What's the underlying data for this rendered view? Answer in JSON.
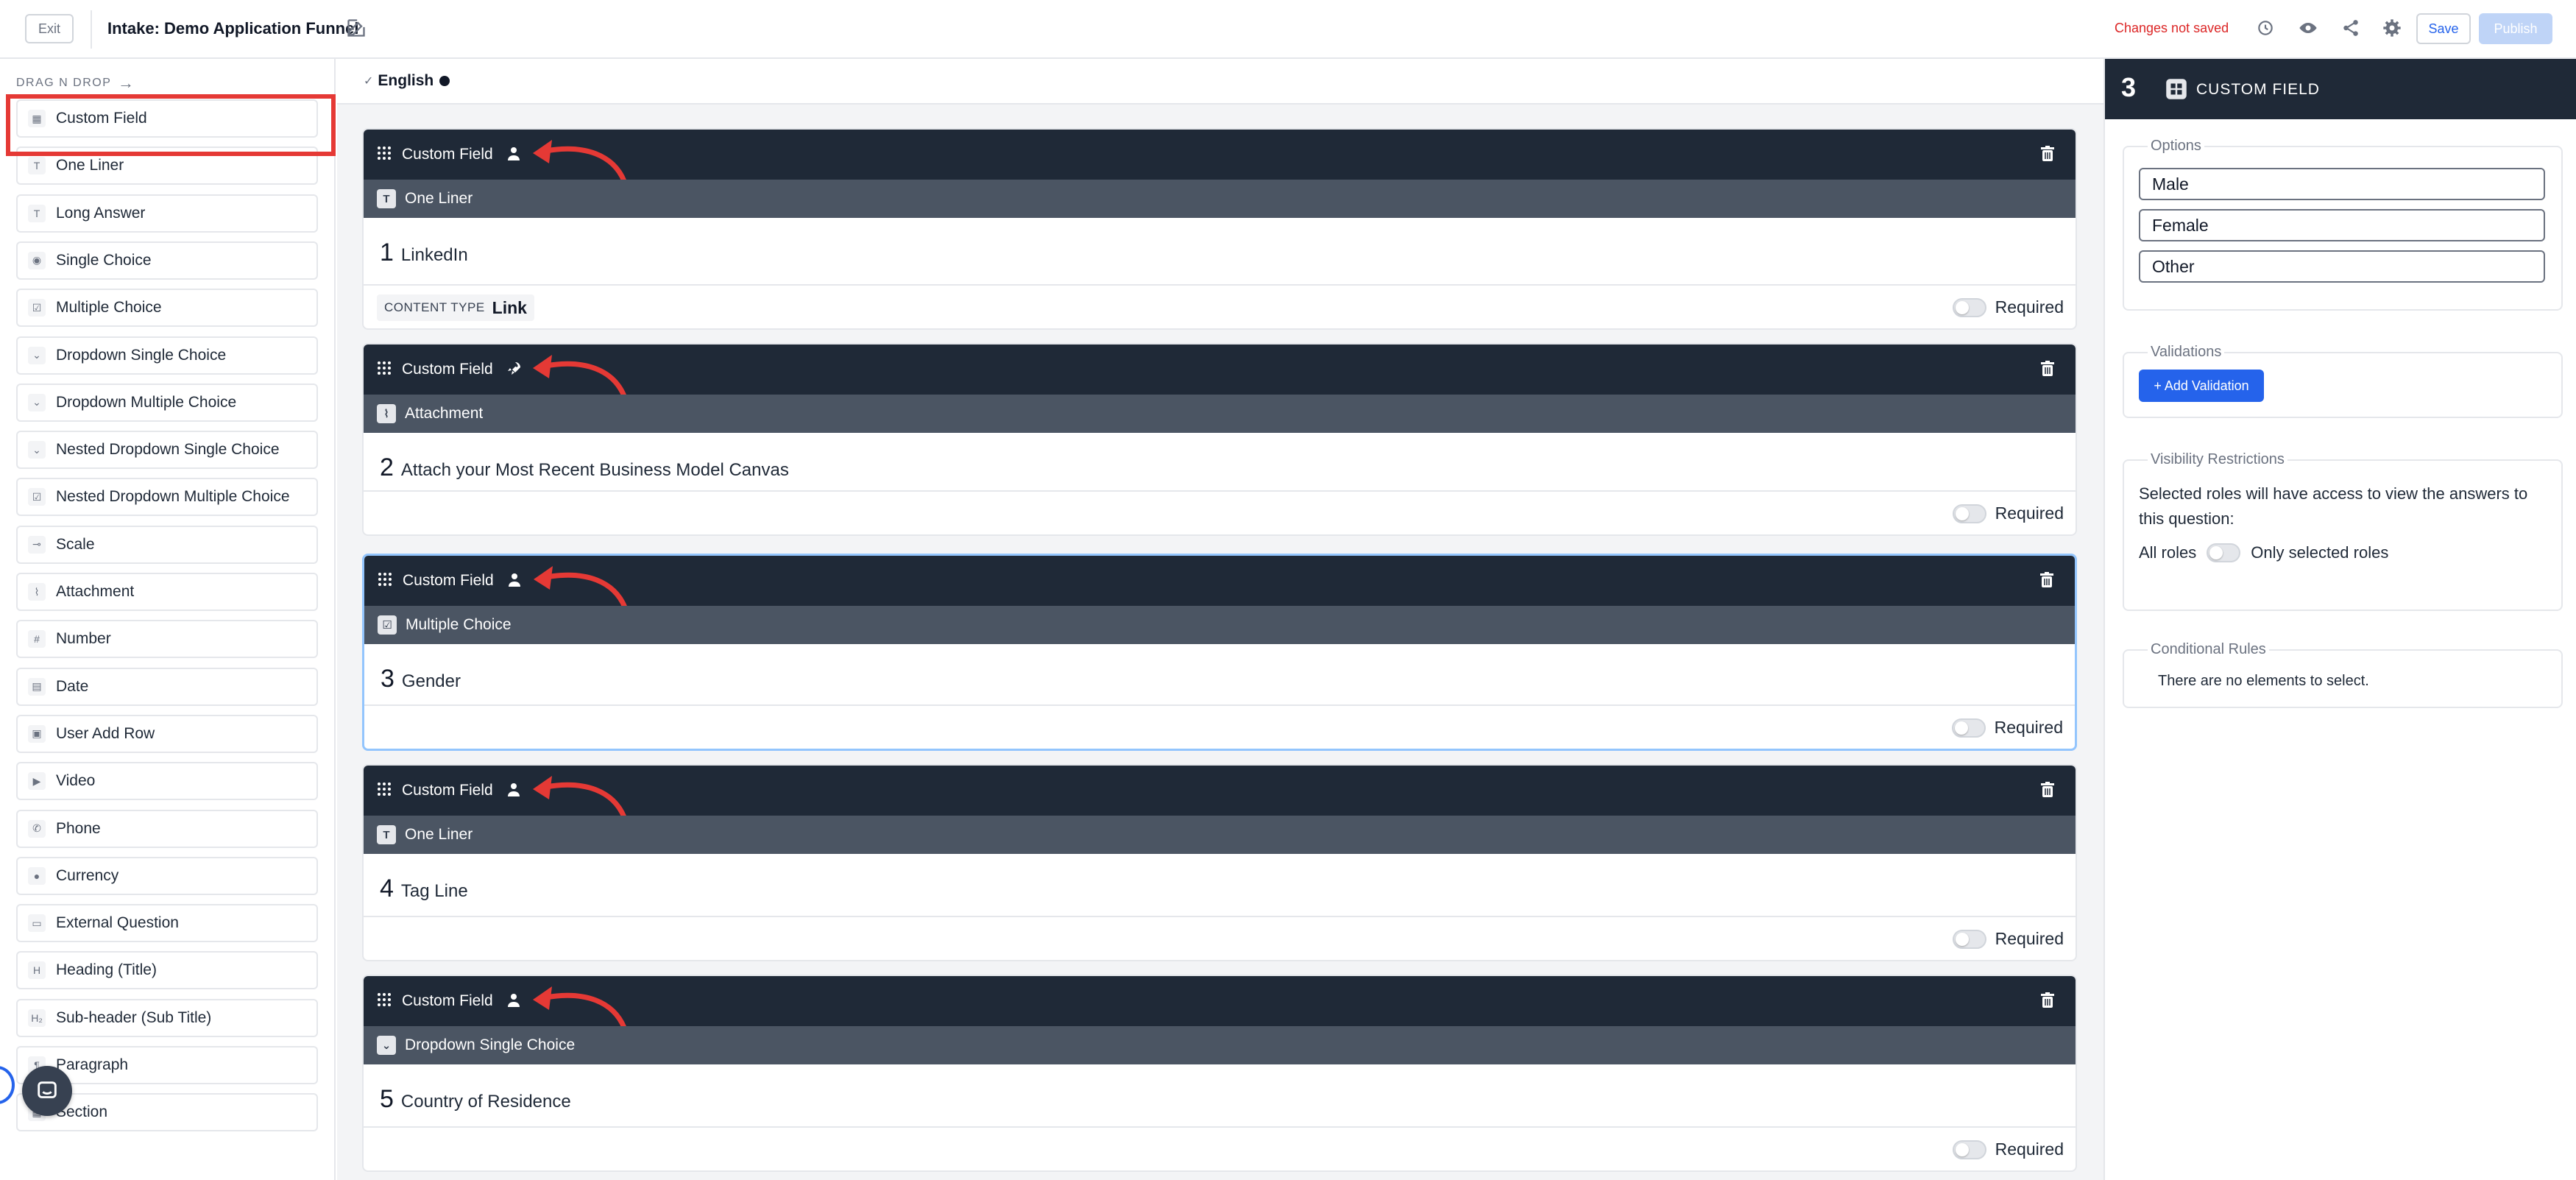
{
  "topbar": {
    "exit_label": "Exit",
    "app_title": "Intake: Demo Application Funnel",
    "unsaved_label": "Changes not saved",
    "save_label": "Save",
    "publish_label": "Publish"
  },
  "sidebar": {
    "heading": "DRAG N DROP",
    "arrow": "→",
    "items": [
      {
        "label": "Custom Field",
        "icon": "grid-icon",
        "glyph": "▦"
      },
      {
        "label": "One Liner",
        "icon": "text-icon",
        "glyph": "T"
      },
      {
        "label": "Long Answer",
        "icon": "text-icon",
        "glyph": "T"
      },
      {
        "label": "Single Choice",
        "icon": "choice-icon",
        "glyph": "◉"
      },
      {
        "label": "Multiple Choice",
        "icon": "choice-icon",
        "glyph": "☑"
      },
      {
        "label": "Dropdown Single Choice",
        "icon": "chevron-down-icon",
        "glyph": "⌄"
      },
      {
        "label": "Dropdown Multiple Choice",
        "icon": "chevron-down-icon",
        "glyph": "⌄"
      },
      {
        "label": "Nested Dropdown Single Choice",
        "icon": "chevron-down-icon",
        "glyph": "⌄"
      },
      {
        "label": "Nested Dropdown Multiple Choice",
        "icon": "choice-icon",
        "glyph": "☑"
      },
      {
        "label": "Scale",
        "icon": "scale-icon",
        "glyph": "⊸"
      },
      {
        "label": "Attachment",
        "icon": "paperclip-icon",
        "glyph": "⌇"
      },
      {
        "label": "Number",
        "icon": "hash-icon",
        "glyph": "#"
      },
      {
        "label": "Date",
        "icon": "calendar-icon",
        "glyph": "▤"
      },
      {
        "label": "User Add Row",
        "icon": "rows-icon",
        "glyph": "▣"
      },
      {
        "label": "Video",
        "icon": "video-icon",
        "glyph": "▶"
      },
      {
        "label": "Phone",
        "icon": "phone-icon",
        "glyph": "✆"
      },
      {
        "label": "Currency",
        "icon": "currency-icon",
        "glyph": "●"
      },
      {
        "label": "External Question",
        "icon": "monitor-icon",
        "glyph": "▭"
      },
      {
        "label": "Heading (Title)",
        "icon": "heading-icon",
        "glyph": "H"
      },
      {
        "label": "Sub-header (Sub Title)",
        "icon": "subheading-icon",
        "glyph": "H₂"
      },
      {
        "label": "Paragraph",
        "icon": "paragraph-icon",
        "glyph": "¶"
      },
      {
        "label": "Section",
        "icon": "section-icon",
        "glyph": "▦"
      }
    ]
  },
  "canvas": {
    "language": "English",
    "cards": [
      {
        "title": "Custom Field",
        "kind_icon": "user-icon",
        "sub_label": "One Liner",
        "sub_glyph": "T",
        "number": "1",
        "question": "LinkedIn",
        "content_type_key": "CONTENT TYPE",
        "content_type_value": "Link",
        "required_label": "Required"
      },
      {
        "title": "Custom Field",
        "kind_icon": "rocket-icon",
        "sub_label": "Attachment",
        "sub_glyph": "⌇",
        "number": "2",
        "question": "Attach your Most Recent Business Model Canvas",
        "required_label": "Required"
      },
      {
        "title": "Custom Field",
        "kind_icon": "user-icon",
        "sub_label": "Multiple Choice",
        "sub_glyph": "☑",
        "number": "3",
        "question": "Gender",
        "required_label": "Required"
      },
      {
        "title": "Custom Field",
        "kind_icon": "user-icon",
        "sub_label": "One Liner",
        "sub_glyph": "T",
        "number": "4",
        "question": "Tag Line",
        "required_label": "Required"
      },
      {
        "title": "Custom Field",
        "kind_icon": "user-icon",
        "sub_label": "Dropdown Single Choice",
        "sub_glyph": "⌄",
        "number": "5",
        "question": "Country of Residence",
        "required_label": "Required"
      }
    ]
  },
  "right_panel": {
    "number": "3",
    "title": "CUSTOM FIELD",
    "options_title": "Options",
    "options": [
      "Male",
      "Female",
      "Other"
    ],
    "validations_title": "Validations",
    "add_validation_label": "+ Add Validation",
    "visibility_title": "Visibility Restrictions",
    "visibility_text": "Selected roles will have access to view the answers to this question:",
    "all_roles_label": "All roles",
    "only_selected_label": "Only selected roles",
    "conditional_title": "Conditional Rules",
    "conditional_text": "There are no elements to select."
  },
  "colors": {
    "dark_header": "#1f2937",
    "sub_header": "#4b5563",
    "accent_blue": "#2563eb",
    "unsaved_red": "#dc2626",
    "annotation_red": "#e53935"
  }
}
